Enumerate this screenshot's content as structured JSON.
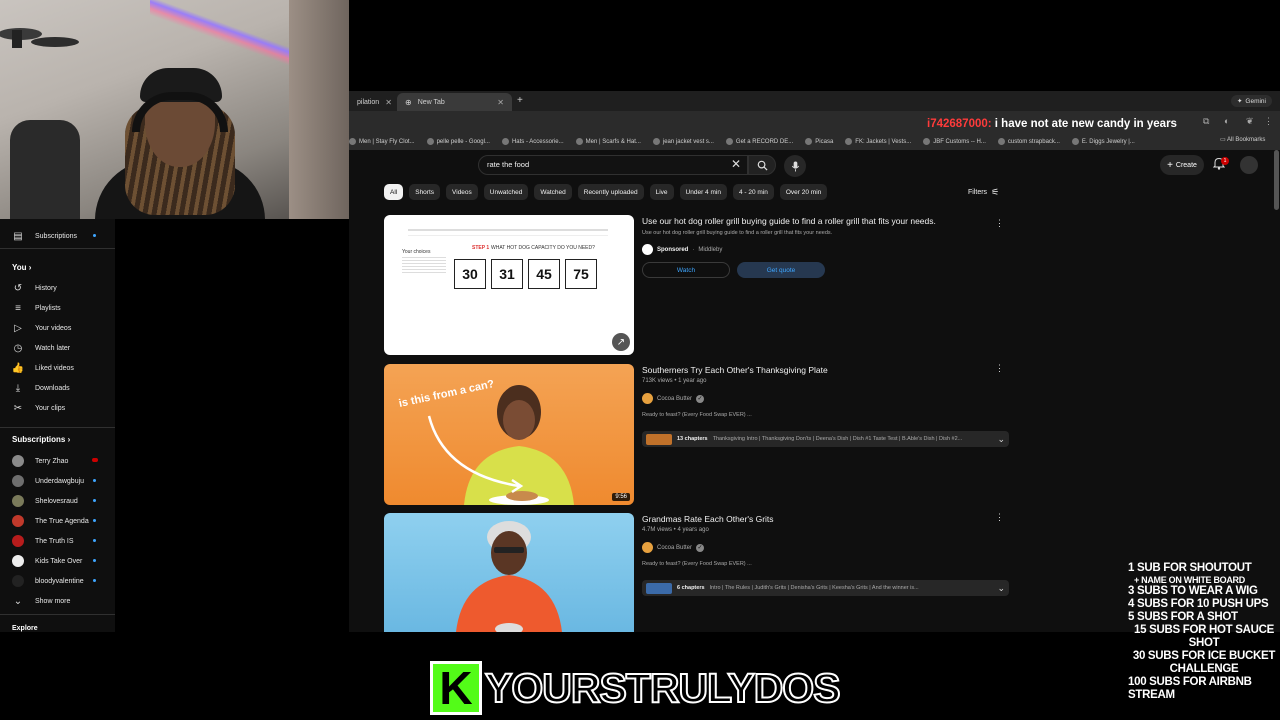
{
  "tabs": [
    {
      "label": "pilation",
      "active": false
    },
    {
      "label": "New Tab",
      "active": true
    }
  ],
  "gemini_label": "Gemini",
  "chat": {
    "user": "i742687000:",
    "message": "i have not ate new candy in years"
  },
  "bookmarks": [
    "Men | Stay Fly Clot...",
    "pelle pelle - Googl...",
    "Hats - Accessorie...",
    "Men | Scarfs & Hat...",
    "jean jacket vest s...",
    "Get a RECORD DE...",
    "Picasa",
    "FK: Jackets | Vests...",
    "JBF Customs -- H...",
    "custom strapback...",
    "E. Diggs Jewelry |..."
  ],
  "all_bookmarks": "All Bookmarks",
  "search": {
    "value": "rate the food"
  },
  "create_label": "Create",
  "notif_count": "1",
  "chips": [
    "All",
    "Shorts",
    "Videos",
    "Unwatched",
    "Watched",
    "Recently uploaded",
    "Live",
    "Under 4 min",
    "4 - 20 min",
    "Over 20 min"
  ],
  "filters_label": "Filters",
  "sidebar": {
    "subscriptions_top": "Subscriptions",
    "you_header": "You",
    "you_items": [
      {
        "icon": "history-icon",
        "label": "History"
      },
      {
        "icon": "playlists-icon",
        "label": "Playlists"
      },
      {
        "icon": "your-videos-icon",
        "label": "Your videos"
      },
      {
        "icon": "watch-later-icon",
        "label": "Watch later"
      },
      {
        "icon": "liked-videos-icon",
        "label": "Liked videos"
      },
      {
        "icon": "downloads-icon",
        "label": "Downloads"
      },
      {
        "icon": "clips-icon",
        "label": "Your clips"
      }
    ],
    "subs_header": "Subscriptions",
    "subs": [
      {
        "label": "Terry Zhao",
        "color": "#8a8a8a",
        "live": true
      },
      {
        "label": "Underdawgbuju",
        "color": "#6e6e6e",
        "live": false
      },
      {
        "label": "Shelovesraud",
        "color": "#7a7a5a",
        "live": false
      },
      {
        "label": "The True Agenda",
        "color": "#c0392b",
        "live": false
      },
      {
        "label": "The Truth IS",
        "color": "#b71c1c",
        "live": false
      },
      {
        "label": "Kids Take Over",
        "color": "#eeeeee",
        "live": false
      },
      {
        "label": "bloodyvalentine",
        "color": "#222222",
        "live": false
      }
    ],
    "show_more": "Show more",
    "explore": "Explore"
  },
  "results": [
    {
      "title": "Use our hot dog roller grill buying guide to find a roller grill that fits your needs.",
      "desc": "Use our hot dog roller grill buying guide to find a roller grill that fits your needs.",
      "sponsored": "Sponsored",
      "advertiser": "Middleby",
      "watch_label": "Watch",
      "quote_label": "Get quote",
      "ad_numbers": [
        "30",
        "31",
        "45",
        "75"
      ],
      "ad_step": "STEP 1",
      "ad_heading": "WHAT HOT DOG CAPACITY DO YOU NEED?",
      "ad_choices": "Your choices"
    },
    {
      "title": "Southerners Try Each Other's Thanksgiving Plate",
      "meta": "713K views • 1 year ago",
      "channel": "Cocoa Butter",
      "desc": "Ready to feast? (Every Food Swap EVER) ...",
      "duration": "9:56",
      "thumb_text": "is this from a can?",
      "chapters_count": "13 chapters",
      "chapters": "Thanksgiving Intro | Thanksgiving Don'ts | Deena's Dish | Dish #1 Taste Test | B.Able's Dish | Dish #2..."
    },
    {
      "title": "Grandmas Rate Each Other's Grits",
      "meta": "4.7M views • 4 years ago",
      "channel": "Cocoa Butter",
      "desc": "Ready to feast? (Every Food Swap EVER) ...",
      "chapters_count": "6 chapters",
      "chapters": "Intro | The Rules | Judith's Grits | Denisha's Grits | Keesha's Grits | And the winner is..."
    }
  ],
  "goals": [
    "1 SUB FOR SHOUTOUT",
    "+ NAME ON WHITE BOARD",
    "3 SUBS TO WEAR A WIG",
    "4 SUBS FOR 10 PUSH UPS",
    "5 SUBS FOR A SHOT",
    "15 SUBS FOR HOT SAUCE SHOT",
    "30 SUBS FOR ICE BUCKET CHALLENGE",
    "100 SUBS FOR AIRBNB STREAM"
  ],
  "brand": {
    "logo_letter": "K",
    "name": "YOURSTRULYDOS",
    "logo_color": "#53fc18"
  }
}
